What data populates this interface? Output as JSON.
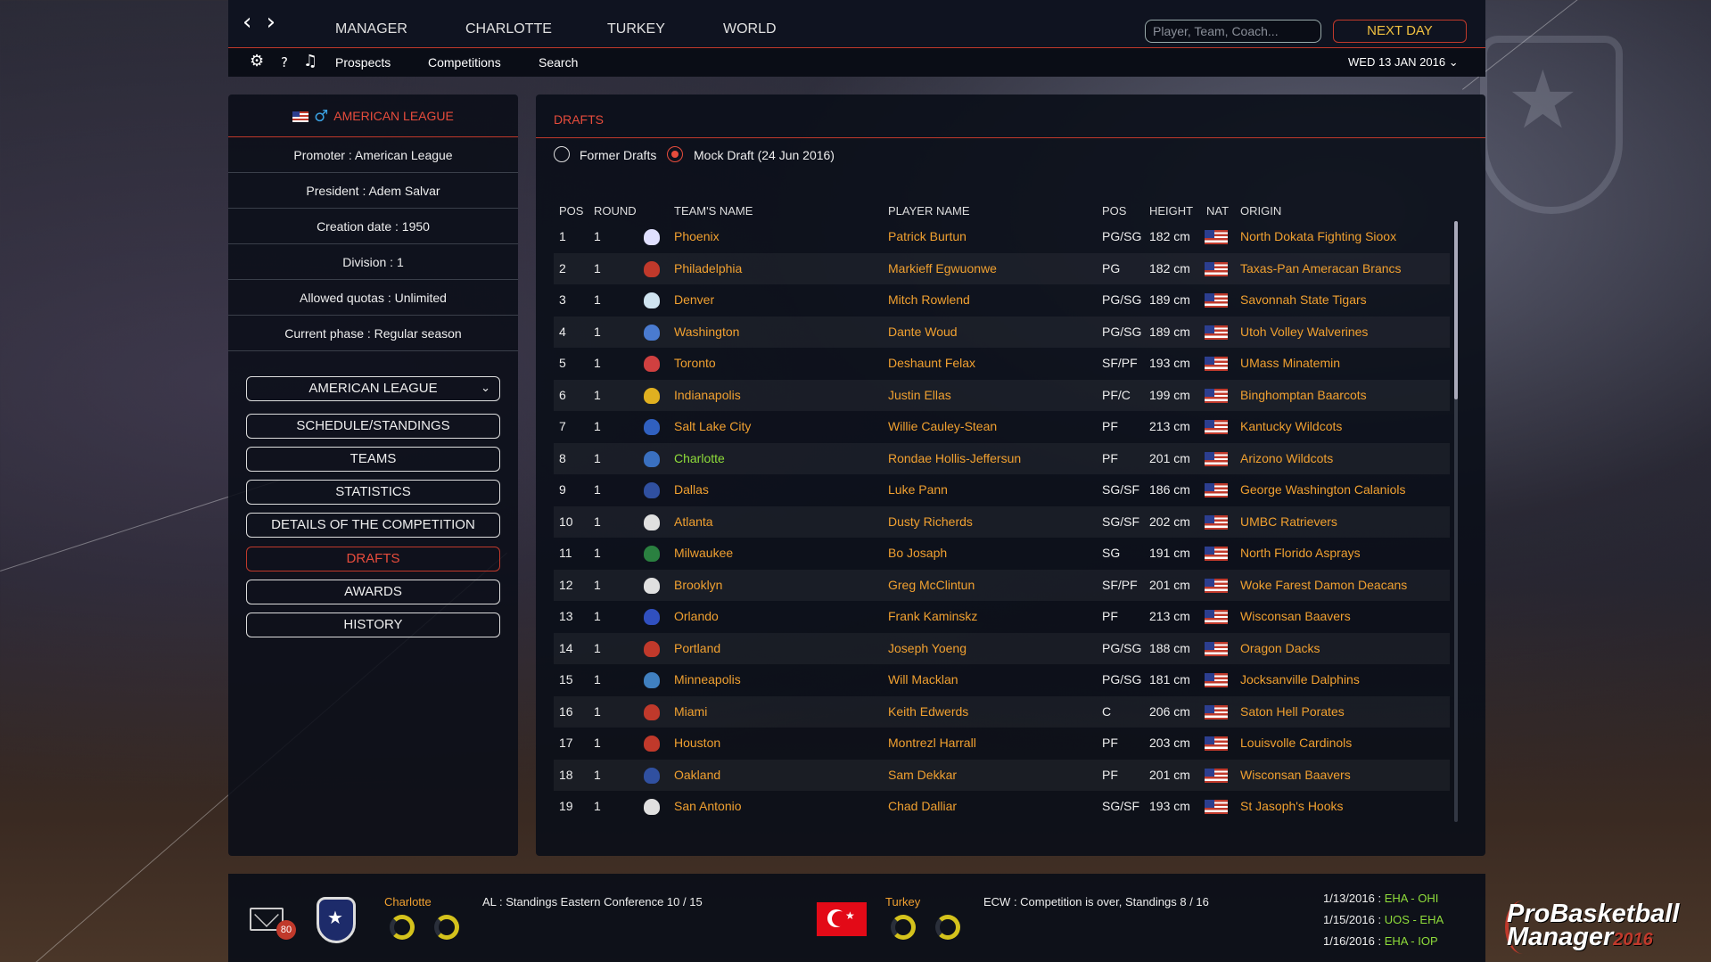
{
  "topnav": {
    "tabs": [
      "MANAGER",
      "CHARLOTTE",
      "TURKEY",
      "WORLD"
    ],
    "search_placeholder": "Player, Team, Coach...",
    "next_day": "NEXT DAY"
  },
  "subnav": {
    "help": "?",
    "links": [
      "Prospects",
      "Competitions",
      "Search"
    ],
    "date": "WED 13 JAN 2016"
  },
  "league": {
    "name": "AMERICAN LEAGUE",
    "info": [
      "Promoter : American League",
      "President : Adem Salvar",
      "Creation date : 1950",
      "Division : 1",
      "Allowed quotas : Unlimited",
      "Current phase : Regular season"
    ],
    "selector": "AMERICAN LEAGUE",
    "menu": [
      "SCHEDULE/STANDINGS",
      "TEAMS",
      "STATISTICS",
      "DETAILS OF THE COMPETITION",
      "DRAFTS",
      "AWARDS",
      "HISTORY"
    ]
  },
  "drafts": {
    "title": "DRAFTS",
    "option_former": "Former Drafts",
    "option_mock": "Mock Draft (24 Jun 2016)",
    "selected_option": "Mock Draft (24 Jun 2016)",
    "columns": [
      "POS",
      "ROUND",
      "TEAM'S NAME",
      "PLAYER NAME",
      "POS",
      "HEIGHT",
      "NAT",
      "ORIGIN"
    ],
    "highlight_color": "#8fdc3a",
    "link_color": "#f0a030",
    "rows": [
      {
        "pos": "1",
        "round": "1",
        "team": "Phoenix",
        "player": "Patrick Burtun",
        "ppos": "PG/SG",
        "height": "182 cm",
        "origin": "North Dokata Fighting Sioox"
      },
      {
        "pos": "2",
        "round": "1",
        "team": "Philadelphia",
        "player": "Markieff Egwuonwe",
        "ppos": "PG",
        "height": "182 cm",
        "origin": "Taxas-Pan Ameracan Brancs"
      },
      {
        "pos": "3",
        "round": "1",
        "team": "Denver",
        "player": "Mitch Rowlend",
        "ppos": "PG/SG",
        "height": "189 cm",
        "origin": "Savonnah State Tigars"
      },
      {
        "pos": "4",
        "round": "1",
        "team": "Washington",
        "player": "Dante Woud",
        "ppos": "PG/SG",
        "height": "189 cm",
        "origin": "Utoh Volley Walverines"
      },
      {
        "pos": "5",
        "round": "1",
        "team": "Toronto",
        "player": "Deshaunt Felax",
        "ppos": "SF/PF",
        "height": "193 cm",
        "origin": "UMass Minatemin"
      },
      {
        "pos": "6",
        "round": "1",
        "team": "Indianapolis",
        "player": "Justin Ellas",
        "ppos": "PF/C",
        "height": "199 cm",
        "origin": "Binghomptan Baarcots"
      },
      {
        "pos": "7",
        "round": "1",
        "team": "Salt Lake City",
        "player": "Willie Cauley-Stean",
        "ppos": "PF",
        "height": "213 cm",
        "origin": "Kantucky Wildcots"
      },
      {
        "pos": "8",
        "round": "1",
        "team": "Charlotte",
        "player": "Rondae Hollis-Jeffersun",
        "ppos": "PF",
        "height": "201 cm",
        "origin": "Arizono Wildcots",
        "highlight": true
      },
      {
        "pos": "9",
        "round": "1",
        "team": "Dallas",
        "player": "Luke Pann",
        "ppos": "SG/SF",
        "height": "186 cm",
        "origin": "George Washington Calaniols"
      },
      {
        "pos": "10",
        "round": "1",
        "team": "Atlanta",
        "player": "Dusty Richerds",
        "ppos": "SG/SF",
        "height": "202 cm",
        "origin": "UMBC Ratrievers"
      },
      {
        "pos": "11",
        "round": "1",
        "team": "Milwaukee",
        "player": "Bo Josaph",
        "ppos": "SG",
        "height": "191 cm",
        "origin": "North Florido Asprays"
      },
      {
        "pos": "12",
        "round": "1",
        "team": "Brooklyn",
        "player": "Greg McClintun",
        "ppos": "SF/PF",
        "height": "201 cm",
        "origin": "Woke Farest Damon Deacans"
      },
      {
        "pos": "13",
        "round": "1",
        "team": "Orlando",
        "player": "Frank Kaminskz",
        "ppos": "PF",
        "height": "213 cm",
        "origin": "Wisconsan Baavers"
      },
      {
        "pos": "14",
        "round": "1",
        "team": "Portland",
        "player": "Joseph Yoeng",
        "ppos": "PG/SG",
        "height": "188 cm",
        "origin": "Oragon Dacks"
      },
      {
        "pos": "15",
        "round": "1",
        "team": "Minneapolis",
        "player": "Will Macklan",
        "ppos": "PG/SG",
        "height": "181 cm",
        "origin": "Jocksanville Dalphins"
      },
      {
        "pos": "16",
        "round": "1",
        "team": "Miami",
        "player": "Keith Edwerds",
        "ppos": "C",
        "height": "206 cm",
        "origin": "Saton Hell Porates"
      },
      {
        "pos": "17",
        "round": "1",
        "team": "Houston",
        "player": "Montrezl Harrall",
        "ppos": "PF",
        "height": "203 cm",
        "origin": "Louisvolle Cardinols"
      },
      {
        "pos": "18",
        "round": "1",
        "team": "Oakland",
        "player": "Sam Dekkar",
        "ppos": "PF",
        "height": "201 cm",
        "origin": "Wisconsan Baavers"
      },
      {
        "pos": "19",
        "round": "1",
        "team": "San Antonio",
        "player": "Chad Dalliar",
        "ppos": "SG/SF",
        "height": "193 cm",
        "origin": "St Jasoph's Hooks"
      }
    ],
    "logo_colors": [
      "#e0e0ff",
      "#c0392b",
      "#cfe3f0",
      "#4a7bd0",
      "#d04040",
      "#e0b020",
      "#3060c0",
      "#3a70c0",
      "#3050a0",
      "#e0e0e0",
      "#2a8040",
      "#e0e0e0",
      "#3050c0",
      "#c0392b",
      "#4080c0",
      "#c0392b",
      "#c0392b",
      "#3050a0",
      "#e0e0e0"
    ]
  },
  "bottom": {
    "mail_count": "80",
    "club_name": "Charlotte",
    "club_status": "AL : Standings Eastern Conference 10 / 15",
    "country_name": "Turkey",
    "country_status": "ECW : Competition is over, Standings 8 / 16",
    "news": [
      {
        "date": "1/13/2016 :",
        "event": "EHA - OHI"
      },
      {
        "date": "1/15/2016 :",
        "event": "UOS - EHA"
      },
      {
        "date": "1/16/2016 :",
        "event": "EHA - IOP"
      }
    ],
    "brand_line1": "ProBasketball",
    "brand_line2": "Manager",
    "brand_year": "2016"
  }
}
